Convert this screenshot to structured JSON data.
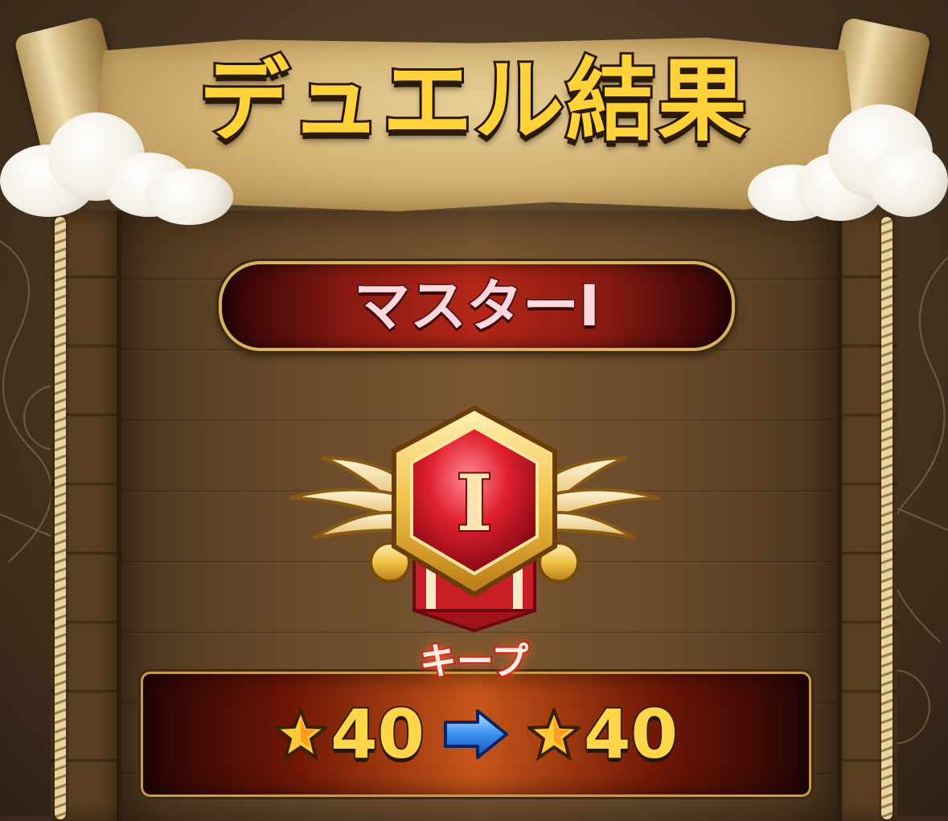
{
  "title": {
    "main": "デュエル結果"
  },
  "rank": {
    "label": "マスターⅠ",
    "emblem_numeral": "I"
  },
  "result": {
    "status": "キープ",
    "stars_before": "40",
    "stars_after": "40",
    "star_icon": "star-icon",
    "arrow_icon": "arrow-right-icon"
  },
  "colors": {
    "title_gold": "#ffd23a",
    "rank_red": "#b42718",
    "panel_orange": "#c8561a",
    "arrow_blue": "#3b8ff0"
  }
}
